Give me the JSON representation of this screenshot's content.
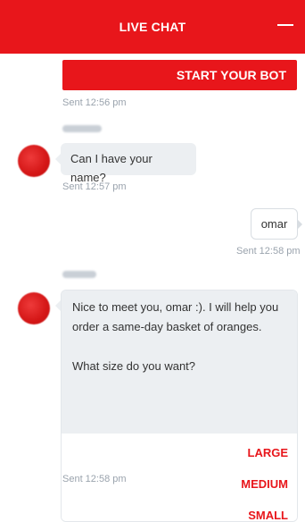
{
  "header": {
    "title": "LIVE CHAT",
    "minimize_icon": "minimize-icon"
  },
  "chat": {
    "start_bot_label": "START YOUR BOT",
    "sent_1": "Sent 12:56 pm",
    "bot_q1": "Can I have your name?",
    "sent_2": "Sent 12:57 pm",
    "user_reply": "omar",
    "sent_3": "Sent 12:58 pm",
    "bot_msg_line1": "Nice to meet you, omar :). I will help you",
    "bot_msg_line2": "order a same-day basket of oranges.",
    "bot_msg_question": "What size do you want?",
    "options": [
      "LARGE",
      "MEDIUM",
      "SMALL"
    ],
    "sent_4": "Sent 12:58 pm"
  },
  "colors": {
    "accent": "#e8161b",
    "bubble": "#eceff2",
    "timestamp": "#9aa3ad"
  }
}
